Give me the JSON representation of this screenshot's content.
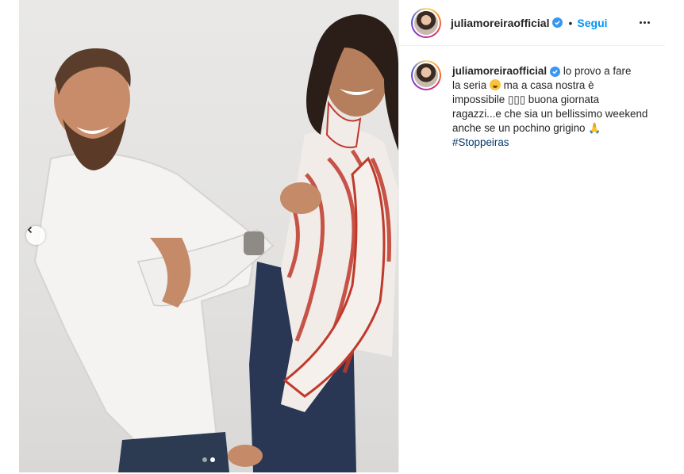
{
  "post": {
    "username": "juliamoreiraofficial",
    "follow_label": "Segui",
    "separator": "•",
    "caption": {
      "username": "juliamoreiraofficial",
      "line1": "lo provo a fare",
      "line2a": "la seria",
      "line2b": "ma a casa nostra è",
      "line3": "impossibile ▯▯▯ buona giornata",
      "line4": "ragazzi...e che sia un bellissimo weekend",
      "line5": "anche se un pochino grigino",
      "hands_emoji": "🙏",
      "hashtag": "#Stoppeiras"
    },
    "carousel": {
      "current_slide": 2,
      "total_slides": 2
    }
  },
  "colors": {
    "link": "#0095f6",
    "hashtag": "#00376b",
    "verified": "#3897f0",
    "text": "#262626"
  },
  "icons": [
    "verified-badge-icon",
    "more-options-icon",
    "chevron-left-icon",
    "grimace-emoji-icon",
    "folded-hands-emoji-icon"
  ]
}
